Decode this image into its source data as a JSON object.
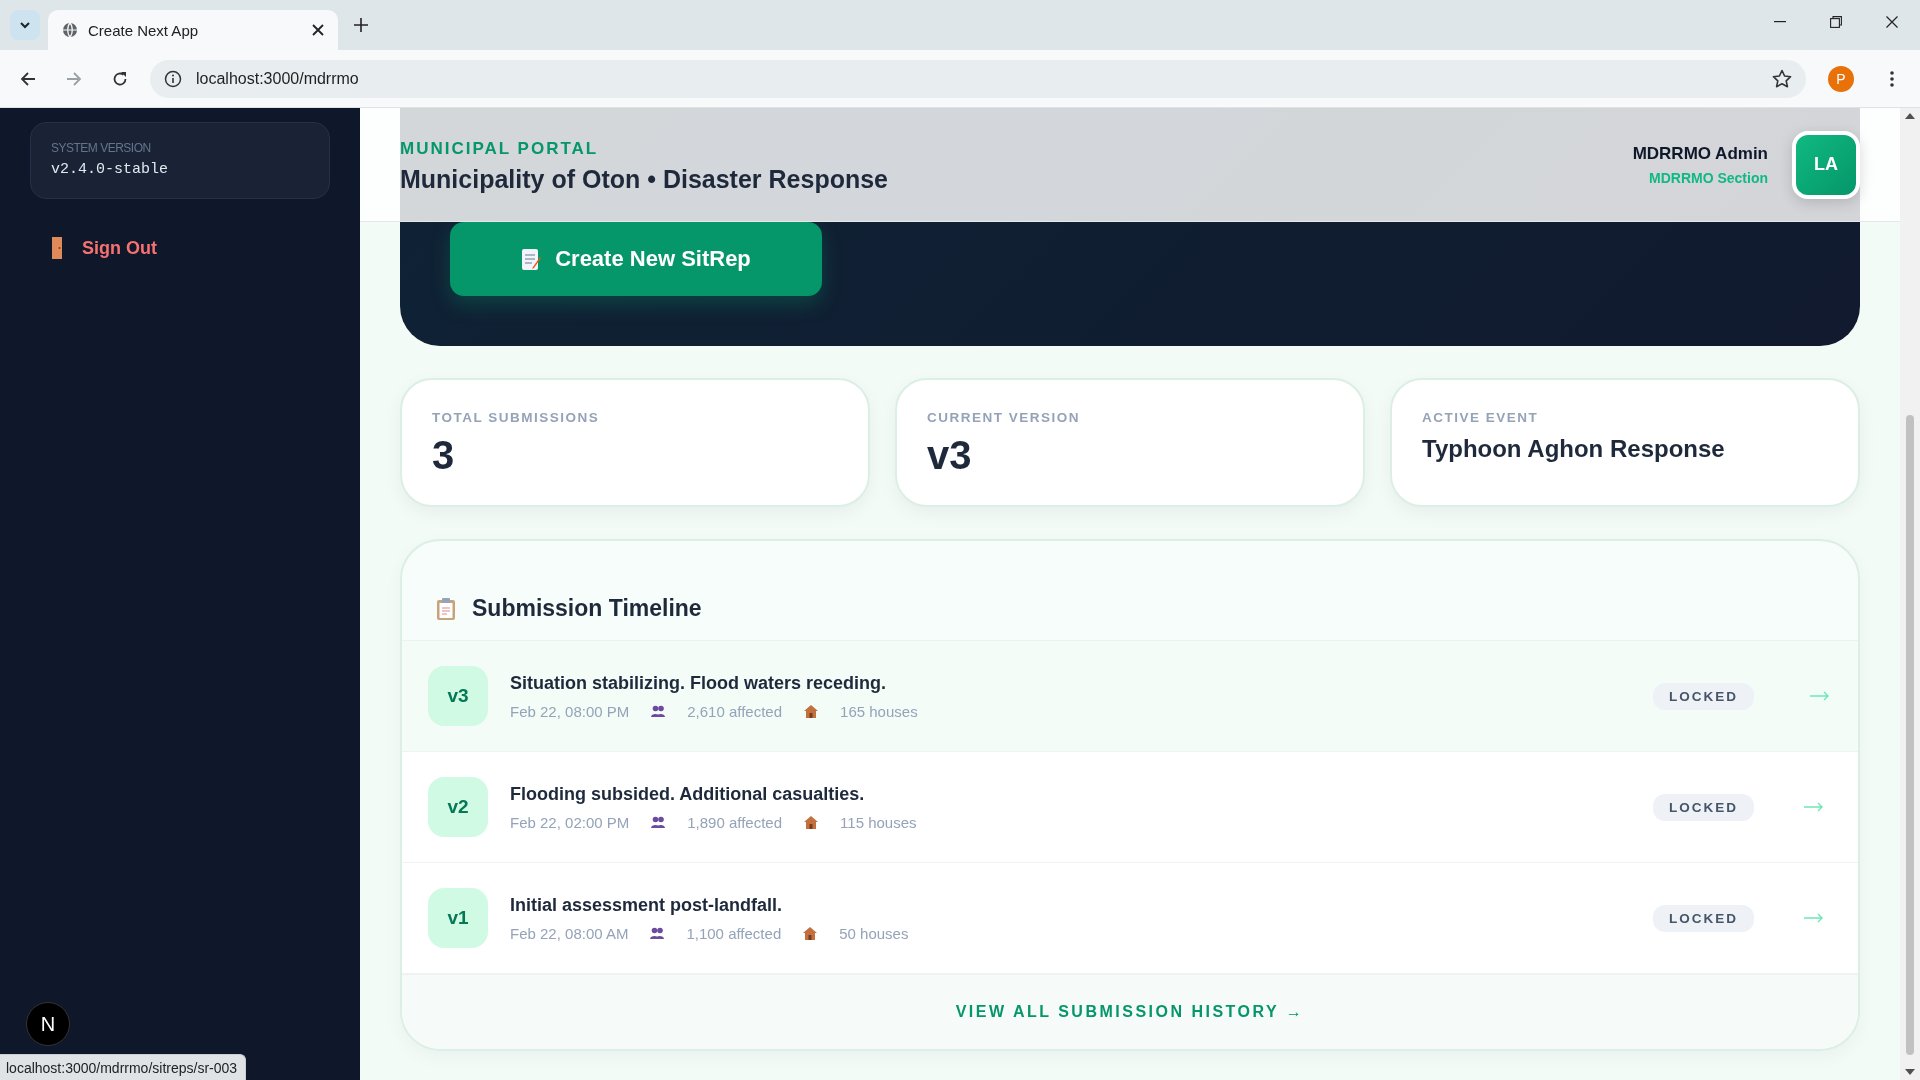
{
  "browser": {
    "tab_title": "Create Next App",
    "url": "localhost:3000/mdrrmo",
    "profile_initial": "P",
    "status_url": "localhost:3000/mdrrmo/sitreps/sr-003"
  },
  "sidebar": {
    "version_label": "SYSTEM VERSION",
    "version": "v2.4.0-stable",
    "sign_out": "Sign Out",
    "dev_badge": "N"
  },
  "hero": {
    "action": "Create New SitRep"
  },
  "header": {
    "eyebrow": "MUNICIPAL PORTAL",
    "title": "Municipality of Oton • Disaster Response",
    "user_name": "MDRRMO Admin",
    "user_role": "MDRRMO Section",
    "avatar": "LA"
  },
  "stats": [
    {
      "kind": "number",
      "label": "TOTAL SUBMISSIONS",
      "value": "3"
    },
    {
      "kind": "number",
      "label": "CURRENT VERSION",
      "value": "v3"
    },
    {
      "kind": "text",
      "label": "ACTIVE EVENT",
      "value": "Typhoon Aghon Response"
    }
  ],
  "timeline": {
    "title": "Submission Timeline",
    "entries": [
      {
        "version": "v3",
        "summary": "Situation stabilizing. Flood waters receding.",
        "time": "Feb 22, 08:00 PM",
        "affected": "2,610 affected",
        "houses": "165 houses",
        "status": "LOCKED",
        "highlighted": true
      },
      {
        "version": "v2",
        "summary": "Flooding subsided. Additional casualties.",
        "time": "Feb 22, 02:00 PM",
        "affected": "1,890 affected",
        "houses": "115 houses",
        "status": "LOCKED",
        "highlighted": false
      },
      {
        "version": "v1",
        "summary": "Initial assessment post-landfall.",
        "time": "Feb 22, 08:00 AM",
        "affected": "1,100 affected",
        "houses": "50 houses",
        "status": "LOCKED",
        "highlighted": false
      }
    ],
    "footer_link": "VIEW ALL SUBMISSION HISTORY →"
  }
}
